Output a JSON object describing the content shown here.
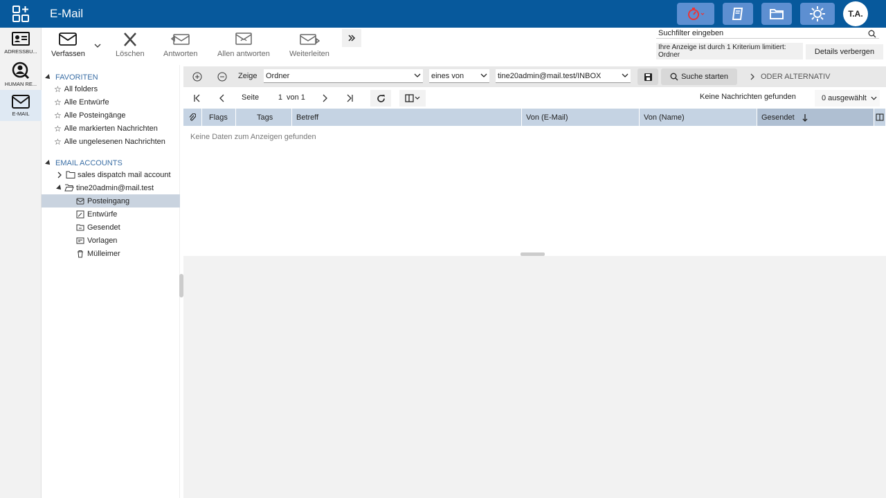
{
  "app": {
    "title": "E-Mail",
    "avatar": "T.A."
  },
  "rail": [
    {
      "label": "ADRESSBU...",
      "icon": "address-card-icon"
    },
    {
      "label": "HUMAN RE...",
      "icon": "user-search-icon"
    },
    {
      "label": "E-MAIL",
      "icon": "mail-icon"
    }
  ],
  "toolbar": {
    "compose": "Verfassen",
    "delete": "Löschen",
    "reply": "Antworten",
    "reply_all": "Allen antworten",
    "forward": "Weiterleiten"
  },
  "search": {
    "placeholder": "Suchfilter eingeben",
    "filter_info": "Ihre Anzeige ist durch 1 Kriterium limitiert: Ordner",
    "details_button": "Details verbergen"
  },
  "tree": {
    "favorites_header": "FAVORITEN",
    "favorites": [
      "All folders",
      "Alle Entwürfe",
      "Alle Posteingänge",
      "Alle markierten Nachrichten",
      "Alle ungelesenen Nachrichten"
    ],
    "accounts_header": "EMAIL ACCOUNTS",
    "accounts": [
      "sales dispatch mail account",
      "tine20admin@mail.test"
    ],
    "folders": [
      "Posteingang",
      "Entwürfe",
      "Gesendet",
      "Vorlagen",
      "Mülleimer"
    ]
  },
  "filter": {
    "show_label": "Zeige",
    "field": "Ordner",
    "operator": "eines von",
    "value": "tine20admin@mail.test/INBOX",
    "search_button": "Suche starten",
    "or_alternative": "ODER ALTERNATIV"
  },
  "paging": {
    "page_label": "Seite",
    "page": "1",
    "of_label": "von 1",
    "no_messages": "Keine Nachrichten gefunden",
    "selected": "0 ausgewählt"
  },
  "grid": {
    "columns": [
      "Flags",
      "Tags",
      "Betreff",
      "Von (E-Mail)",
      "Von (Name)",
      "Gesendet"
    ],
    "empty": "Keine Daten zum Anzeigen gefunden"
  },
  "colors": {
    "topbar": "#07599c",
    "accent_button": "#5d8fd1",
    "grid_header": "#c5d3e3",
    "selected": "#c9d3df"
  }
}
